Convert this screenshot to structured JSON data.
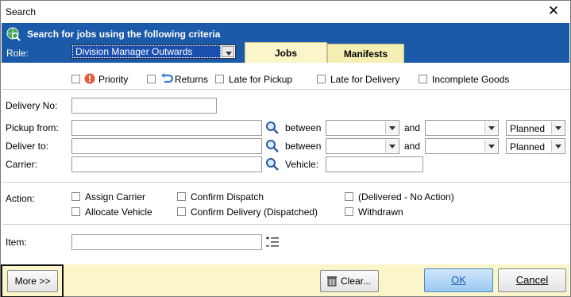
{
  "window": {
    "title": "Search",
    "close_glyph": "✕"
  },
  "banner": {
    "title": "Search for jobs using the following criteria",
    "icon": "globe-search-icon",
    "role_label": "Role:",
    "role_value": "Division Manager Outwards",
    "bg_color": "#1a5aa8"
  },
  "tabs": [
    {
      "label": "Jobs"
    },
    {
      "label": "Manifests"
    }
  ],
  "filters": {
    "priority": "Priority",
    "returns": "Returns",
    "late_pickup": "Late for Pickup",
    "late_delivery": "Late for Delivery",
    "incomplete": "Incomplete Goods"
  },
  "form": {
    "delivery_no_label": "Delivery No:",
    "pickup_label": "Pickup from:",
    "deliver_label": "Deliver to:",
    "carrier_label": "Carrier:",
    "between_label": "between",
    "and_label": "and",
    "vehicle_label": "Vehicle:",
    "planned_1": "Planned",
    "planned_2": "Planned"
  },
  "action": {
    "label": "Action:",
    "assign_carrier": "Assign Carrier",
    "allocate_vehicle": "Allocate Vehicle",
    "confirm_dispatch": "Confirm Dispatch",
    "confirm_delivery": "Confirm Delivery (Dispatched)",
    "delivered_no_action": "(Delivered - No Action)",
    "withdrawn": "Withdrawn"
  },
  "item": {
    "label": "Item:"
  },
  "footer": {
    "more": "More >>",
    "clear": "Clear...",
    "ok": "OK",
    "cancel": "Cancel",
    "bg_color": "#fbf6c9"
  }
}
